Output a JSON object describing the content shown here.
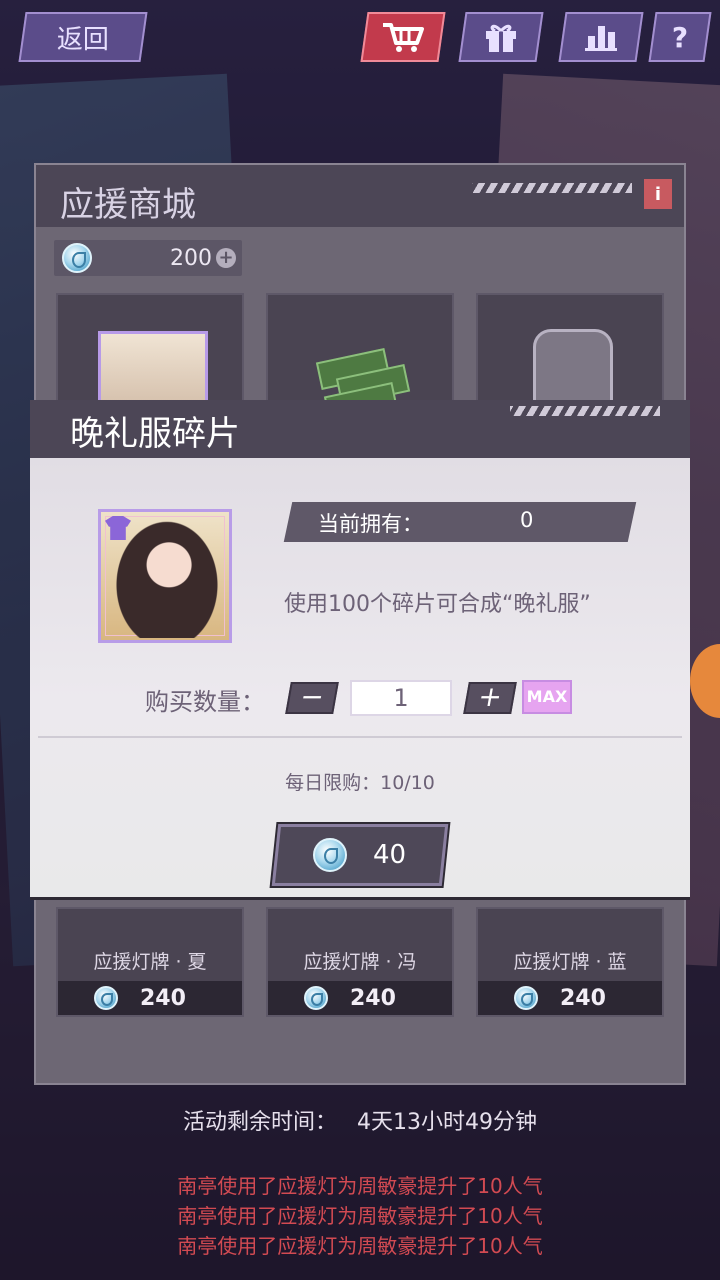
{
  "topbar": {
    "back_label": "返回",
    "help_label": "?"
  },
  "shop": {
    "title": "应援商城",
    "info_label": "i",
    "currency_value": "200",
    "currency_plus": "+",
    "bottom_items": [
      {
        "name": "应援灯牌 · 夏",
        "price": "240"
      },
      {
        "name": "应援灯牌 · 冯",
        "price": "240"
      },
      {
        "name": "应援灯牌 · 蓝",
        "price": "240"
      }
    ]
  },
  "modal": {
    "title": "晚礼服碎片",
    "owned_label": "当前拥有：",
    "owned_value": "0",
    "description": "使用100个碎片可合成“晚礼服”",
    "quantity_label": "购买数量：",
    "minus_label": "−",
    "plus_label": "+",
    "quantity_value": "1",
    "max_label": "MAX",
    "daily_limit": "每日限购：10/10",
    "buy_price": "40"
  },
  "footer": {
    "timer_label": "活动剩余时间：",
    "timer_value": "4天13小时49分钟",
    "log": [
      "南亭使用了应援灯为周敏豪提升了10人气",
      "南亭使用了应援灯为周敏豪提升了10人气",
      "南亭使用了应援灯为周敏豪提升了10人气"
    ]
  },
  "colors": {
    "accent_purple": "#5b4c8a",
    "shop_red": "#c23a4c",
    "log_red": "#d24a52",
    "max_pink": "#e6a4f0"
  },
  "icons": [
    "cart-icon",
    "gift-icon",
    "ranking-icon",
    "help-icon",
    "coin-icon",
    "shirt-icon"
  ]
}
